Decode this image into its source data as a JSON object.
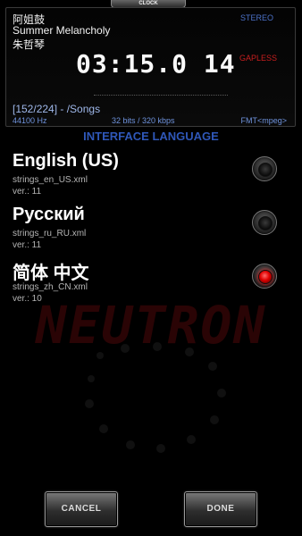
{
  "clock_tab": "CLOCK",
  "now_playing": {
    "artist": "阿姐鼓",
    "track": "Summer Melancholy",
    "album": "朱哲琴",
    "time": "03:15.0 14",
    "stereo": "STEREO",
    "gapless": "GAPLESS",
    "playlist": "[152/224] - /Songs",
    "frequency": "44100 Hz",
    "bitrate": "32 bits / 320 kbps",
    "format": "FMT<mpeg>"
  },
  "heading": "INTERFACE LANGUAGE",
  "languages": [
    {
      "name": "English (US)",
      "file": "strings_en_US.xml",
      "version": "ver.: 11",
      "selected": false
    },
    {
      "name": "Русский",
      "file": "strings_ru_RU.xml",
      "version": "ver.: 11",
      "selected": false
    },
    {
      "name": "简体 中文",
      "file": "strings_zh_CN.xml",
      "version": "ver.: 10",
      "selected": true
    }
  ],
  "background_logo": "NEUTRON",
  "buttons": {
    "cancel": "CANCEL",
    "done": "DONE"
  },
  "colors": {
    "accent_blue": "#2f57b8",
    "gapless_red": "#c81e1e",
    "radio_selected": "#e10000"
  }
}
